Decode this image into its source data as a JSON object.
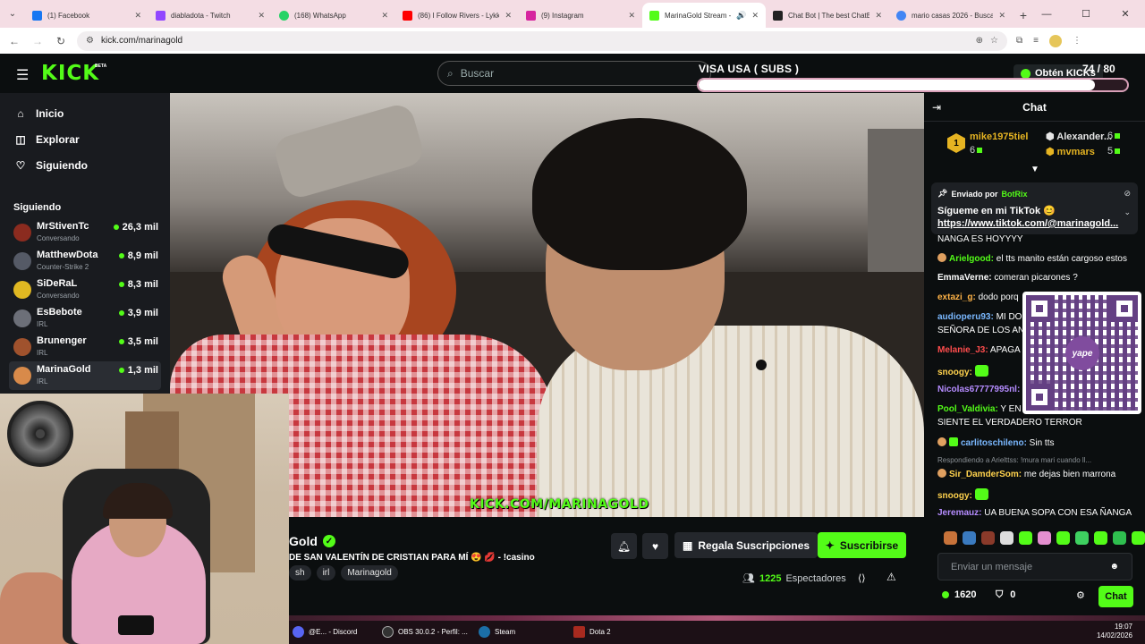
{
  "browser": {
    "tabs": [
      {
        "title": "(1) Facebook",
        "color": "#1877f2"
      },
      {
        "title": "diabladota - Twitch",
        "color": "#9146ff"
      },
      {
        "title": "(168) WhatsApp",
        "color": "#25d366"
      },
      {
        "title": "(86) I Follow Rivers - Lykke",
        "color": "#ff0000"
      },
      {
        "title": "(9) Instagram",
        "color": "#d6249f"
      },
      {
        "title": "MarinaGold Stream - ",
        "color": "#53fc18"
      },
      {
        "title": "Chat Bot | The best ChatB",
        "color": "#222222"
      },
      {
        "title": "mario casas 2026 - Buscar",
        "color": "#4285f4"
      }
    ],
    "url": "kick.com/marinagold"
  },
  "header": {
    "logo": "KICK",
    "logo_beta": "BETA",
    "search_placeholder": "Buscar",
    "kicks_button": "Obtén KICKs"
  },
  "goal": {
    "title": "VISA USA ( SUBS )",
    "count": "74 / 80",
    "progress": 0.925
  },
  "sidebar": {
    "nav": [
      {
        "label": "Inicio",
        "icon": "home-icon"
      },
      {
        "label": "Explorar",
        "icon": "compass-icon"
      },
      {
        "label": "Siguiendo",
        "icon": "heart-icon"
      }
    ],
    "following_header": "Siguiendo",
    "following": [
      {
        "name": "MrStivenTc",
        "category": "Conversando",
        "viewers": "26,3 mil",
        "color": "#8b2b1f"
      },
      {
        "name": "MatthewDota",
        "category": "Counter-Strike 2",
        "viewers": "8,9 mil",
        "color": "#555a66"
      },
      {
        "name": "SiDeRaL",
        "category": "Conversando",
        "viewers": "8,3 mil",
        "color": "#e0b822"
      },
      {
        "name": "EsBebote",
        "category": "IRL",
        "viewers": "3,9 mil",
        "color": "#6c6f78"
      },
      {
        "name": "Brunenger",
        "category": "IRL",
        "viewers": "3,5 mil",
        "color": "#a0522d"
      },
      {
        "name": "MarinaGold",
        "category": "IRL",
        "viewers": "1,3 mil",
        "color": "#d88a4a"
      }
    ]
  },
  "video": {
    "watermark": "KICK.COM/MARINAGOLD"
  },
  "stream": {
    "channel_name": "Gold",
    "title": "DE SAN VALENTÍN DE CRISTIAN PARA MÍ 😍 💋 - !casino",
    "tags": [
      "sh",
      "irl",
      "Marinagold"
    ],
    "gift_label": "Regala Suscripciones",
    "subscribe_label": "Suscribirse",
    "viewers_count": "1225",
    "viewers_label": "Espectadores"
  },
  "chat": {
    "title": "Chat",
    "leaderboard": {
      "rank": "1",
      "first_user": "mike1975tiel",
      "first_count": "6",
      "second_user": "Alexander...",
      "second_count": "6",
      "third_user": "mvmars",
      "third_count": "5"
    },
    "pinned": {
      "by_label": "Enviado por",
      "bot": "BotRix",
      "message": "Sígueme en mi TikTok 😊",
      "link": "https://www.tiktok.com/@marinagold..."
    },
    "messages": [
      {
        "user": "",
        "text": "NANGA ES HOYYYY",
        "color": "#ffffff"
      },
      {
        "user": "Arielgood:",
        "text": " el tts manito están cargoso estos",
        "color": "#53fc18"
      },
      {
        "user": "EmmaVerne:",
        "text": " comeran picarones ?",
        "color": "#ffffff"
      },
      {
        "user": "extazi_g:",
        "text": " dodo porq",
        "color": "#ffb347"
      },
      {
        "user": "audioperu93:",
        "text": " MI DO",
        "color": "#7ab8ff"
      },
      {
        "user": "",
        "text": "SEÑORA DE LOS AN",
        "color": "#ffffff"
      },
      {
        "user": "Melanie_J3:",
        "text": " APAGA",
        "color": "#ff4d4d"
      },
      {
        "user": "snoogy:",
        "text": "",
        "color": "#ffd24d"
      },
      {
        "user": "Nicolas67777995nl:",
        "text": "",
        "color": "#b58cff"
      },
      {
        "user": "Pool_Valdivia:",
        "text": " Y EN E",
        "color": "#53fc18"
      },
      {
        "user": "",
        "text": "SIENTE EL VERDADERO TERROR",
        "color": "#ffffff"
      },
      {
        "user": "carlitoschileno:",
        "text": " Sin tts",
        "color": "#7ab8ff"
      },
      {
        "user": "Sir_DamderSom:",
        "text": " me dejas bien marrona",
        "color": "#ffd24d"
      },
      {
        "user": "snoogy:",
        "text": "",
        "color": "#ffd24d"
      },
      {
        "user": "Jeremauz:",
        "text": " UA BUENA SOPA CON ESA ÑANGA",
        "color": "#b58cff"
      }
    ],
    "reply_note": "Respondiendo a Arielttss: !mura mari cuando ll...",
    "input_placeholder": "Enviar un mensaje",
    "kicks_balance": "1620",
    "points": "0",
    "chat_button": "Chat"
  },
  "qr": {
    "brand": "yape"
  },
  "taskbar": {
    "items": [
      "@E... - Discord",
      "OBS 30.0.2 - Perfil: ...",
      "Steam",
      "Dota 2"
    ],
    "time": "19:07",
    "date": "14/02/2026"
  }
}
